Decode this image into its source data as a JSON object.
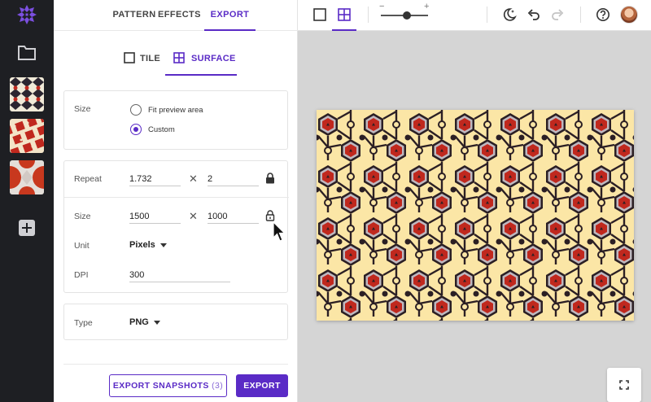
{
  "rail": {
    "icons": {
      "logo": "sparkle-logo-icon",
      "folder": "folder-icon",
      "add": "plus-square-icon"
    },
    "accent": "#5a2bc6"
  },
  "panel": {
    "tabs": [
      {
        "label": "PATTERN"
      },
      {
        "label": "EFFECTS"
      },
      {
        "label": "EXPORT"
      }
    ],
    "subtabs": [
      {
        "label": "TILE"
      },
      {
        "label": "SURFACE"
      }
    ],
    "size_section": {
      "label": "Size",
      "options": [
        {
          "label": "Fit preview area"
        },
        {
          "label": "Custom"
        }
      ]
    },
    "repeat": {
      "label": "Repeat",
      "x": "1.732",
      "y": "2"
    },
    "size": {
      "label": "Size",
      "width": "1500",
      "height": "1000"
    },
    "unit": {
      "label": "Unit",
      "value": "Pixels"
    },
    "dpi": {
      "label": "DPI",
      "value": "300"
    },
    "type": {
      "label": "Type",
      "value": "PNG"
    },
    "times_symbol": "✕",
    "buttons": {
      "snapshots_label": "EXPORT SNAPSHOTS",
      "snapshots_count": "(3)",
      "export_label": "EXPORT"
    }
  },
  "toolbar": {
    "zoom_minus": "−",
    "zoom_plus": "+",
    "zoom_level": 0.55,
    "icons": [
      "tile-view-icon",
      "surface-view-icon",
      "dark-mode-icon",
      "undo-icon",
      "redo-icon",
      "help-icon"
    ]
  },
  "colors": {
    "accent": "#5a2bc6",
    "pattern_red": "#c0281e",
    "pattern_cream": "#fbe6a6",
    "pattern_dark": "#2b1f24",
    "pattern_gray": "#bfb8bf",
    "canvas_bg": "#d5d5d5"
  }
}
